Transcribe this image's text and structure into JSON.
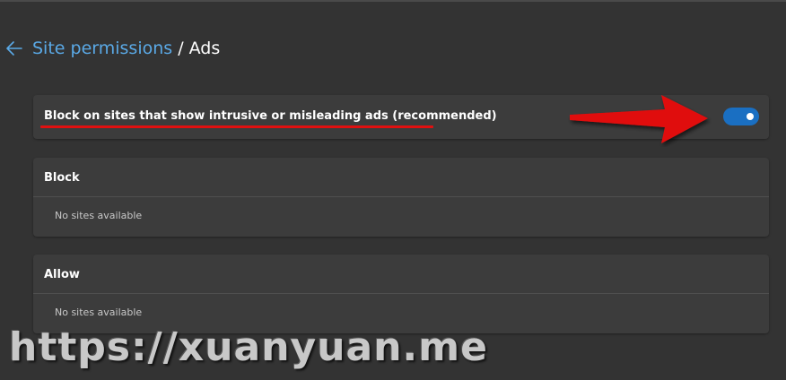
{
  "header": {
    "breadcrumb_link": "Site permissions",
    "separator": "/",
    "current": "Ads"
  },
  "toggle_setting": {
    "label": "Block on sites that show intrusive or misleading ads (recommended)",
    "enabled": true
  },
  "sections": [
    {
      "title": "Block",
      "empty_text": "No sites available"
    },
    {
      "title": "Allow",
      "empty_text": "No sites available"
    }
  ],
  "watermark": "https://xuanyuan.me",
  "colors": {
    "background": "#333333",
    "card": "#3c3c3c",
    "link": "#5aa9e6",
    "toggle_on": "#1a6fc2",
    "annotation_red": "#e01010"
  },
  "icons": {
    "back": "arrow-left-icon",
    "annotation": "red-arrow-icon"
  }
}
